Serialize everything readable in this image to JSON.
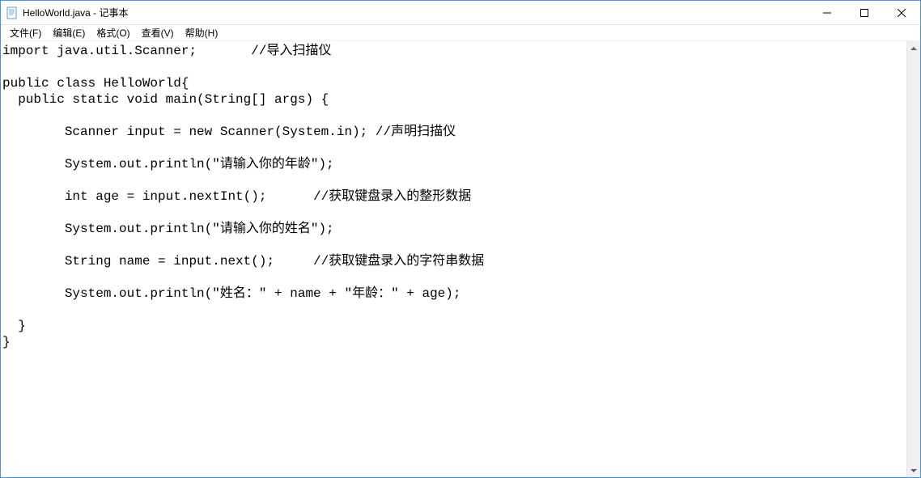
{
  "window": {
    "title": "HelloWorld.java - 记事本"
  },
  "menu": {
    "file": "文件(F)",
    "edit": "编辑(E)",
    "format": "格式(O)",
    "view": "查看(V)",
    "help": "帮助(H)"
  },
  "editor": {
    "content": "import java.util.Scanner;       //导入扫描仪\n\npublic class HelloWorld{\n  public static void main(String[] args) {\n\n        Scanner input = new Scanner(System.in); //声明扫描仪\n\n        System.out.println(\"请输入你的年龄\");\n\n        int age = input.nextInt();      //获取键盘录入的整形数据\n\n        System.out.println(\"请输入你的姓名\");\n\n        String name = input.next();     //获取键盘录入的字符串数据\n\n        System.out.println(\"姓名：\" + name + \"年龄：\" + age);\n\n  }\n}"
  }
}
